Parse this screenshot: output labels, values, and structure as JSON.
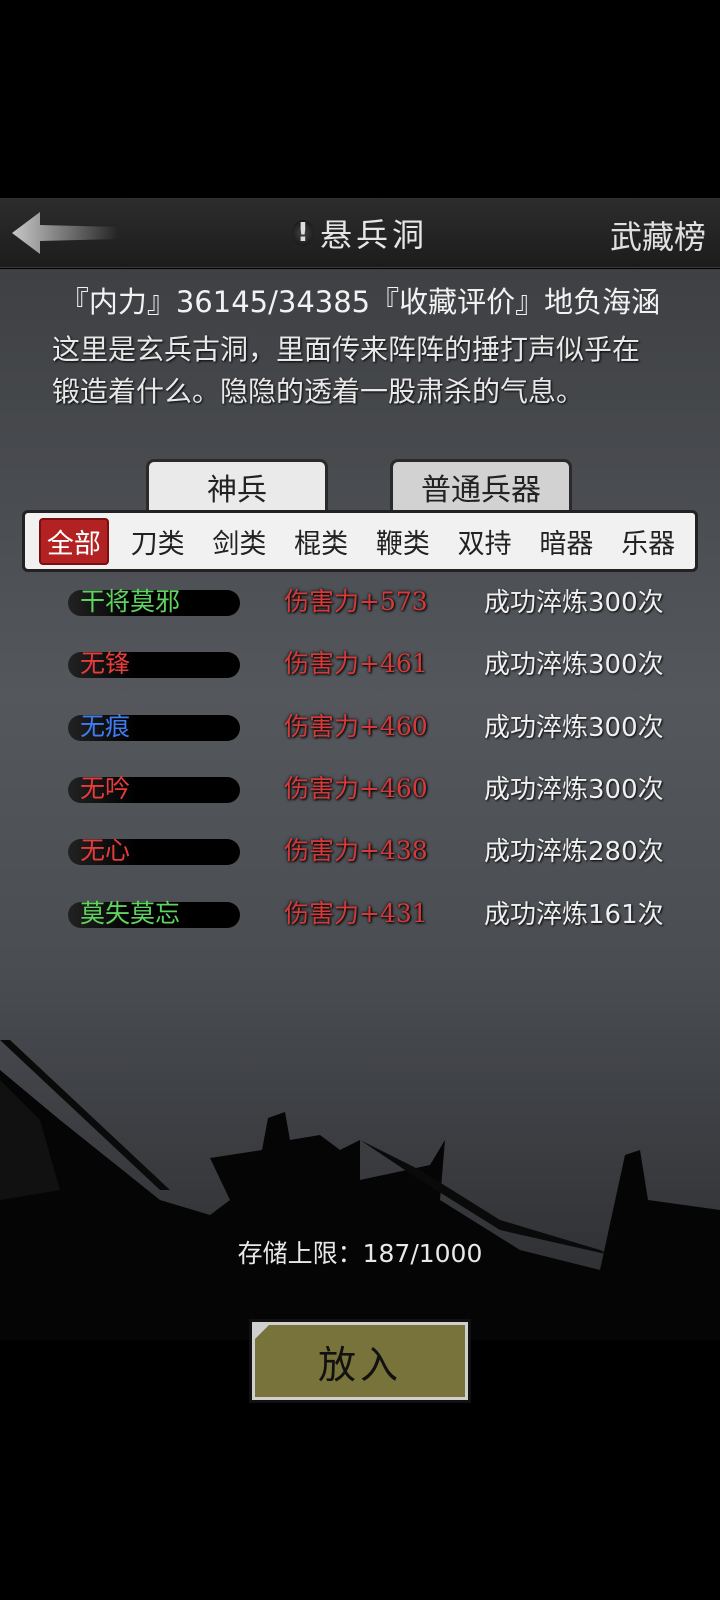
{
  "header": {
    "back_icon": "back-arrow-icon",
    "title_mark": "!",
    "title": "悬兵洞",
    "right_label": "武藏榜"
  },
  "stats": {
    "text": "『内力』36145/34385『收藏评价』地负海涵"
  },
  "description": "这里是玄兵古洞，里面传来阵阵的捶打声似乎在锻造着什么。隐隐的透着一股肃杀的气息。",
  "tabs": [
    {
      "label": "神兵",
      "active": true
    },
    {
      "label": "普通兵器",
      "active": false
    }
  ],
  "filters": [
    {
      "label": "全部",
      "active": true
    },
    {
      "label": "刀类"
    },
    {
      "label": "剑类"
    },
    {
      "label": "棍类"
    },
    {
      "label": "鞭类"
    },
    {
      "label": "双持"
    },
    {
      "label": "暗器"
    },
    {
      "label": "乐器"
    }
  ],
  "items": [
    {
      "name": "干将莫邪",
      "damage": "伤害力+573",
      "refine": "成功淬炼300次",
      "color": "#5fd35f"
    },
    {
      "name": "无锋",
      "damage": "伤害力+461",
      "refine": "成功淬炼300次",
      "color": "#e83b3b"
    },
    {
      "name": "无痕",
      "damage": "伤害力+460",
      "refine": "成功淬炼300次",
      "color": "#3e7cf0"
    },
    {
      "name": "无吟",
      "damage": "伤害力+460",
      "refine": "成功淬炼300次",
      "color": "#e83b3b"
    },
    {
      "name": "无心",
      "damage": "伤害力+438",
      "refine": "成功淬炼280次",
      "color": "#e83b3b"
    },
    {
      "name": "莫失莫忘",
      "damage": "伤害力+431",
      "refine": "成功淬炼161次",
      "color": "#5fd35f"
    }
  ],
  "capacity": "存储上限：187/1000",
  "place_button": "放入",
  "colors": {
    "active_filter": "#b22222",
    "damage_text": "#d43a3a",
    "place_button_bg": "#77733a"
  }
}
